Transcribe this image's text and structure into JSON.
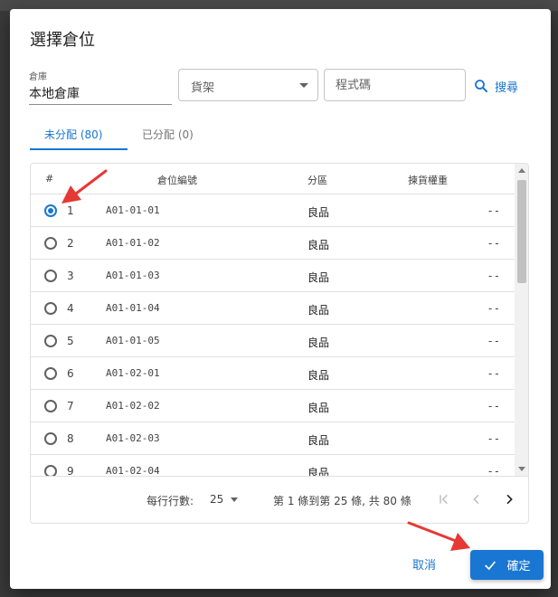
{
  "dialog": {
    "title": "選擇倉位",
    "warehouse": {
      "label": "倉庫",
      "value": "本地倉庫"
    },
    "shelf": {
      "placeholder": "貨架"
    },
    "code": {
      "placeholder": "程式碼"
    },
    "search_label": "搜尋",
    "tabs": [
      {
        "label": "未分配 (80)",
        "active": true
      },
      {
        "label": "已分配 (0)",
        "active": false
      }
    ],
    "table": {
      "headers": {
        "index": "#",
        "code": "倉位編號",
        "zone": "分區",
        "weight": "揀貨權重"
      },
      "rows": [
        {
          "num": "1",
          "code": "A01-01-01",
          "zone": "良品",
          "weight": "--",
          "selected": true
        },
        {
          "num": "2",
          "code": "A01-01-02",
          "zone": "良品",
          "weight": "--",
          "selected": false
        },
        {
          "num": "3",
          "code": "A01-01-03",
          "zone": "良品",
          "weight": "--",
          "selected": false
        },
        {
          "num": "4",
          "code": "A01-01-04",
          "zone": "良品",
          "weight": "--",
          "selected": false
        },
        {
          "num": "5",
          "code": "A01-01-05",
          "zone": "良品",
          "weight": "--",
          "selected": false
        },
        {
          "num": "6",
          "code": "A01-02-01",
          "zone": "良品",
          "weight": "--",
          "selected": false
        },
        {
          "num": "7",
          "code": "A01-02-02",
          "zone": "良品",
          "weight": "--",
          "selected": false
        },
        {
          "num": "8",
          "code": "A01-02-03",
          "zone": "良品",
          "weight": "--",
          "selected": false
        },
        {
          "num": "9",
          "code": "A01-02-04",
          "zone": "良品",
          "weight": "--",
          "selected": false
        }
      ]
    },
    "pagination": {
      "rows_per_page_label": "每行行數:",
      "rows_per_page": "25",
      "range_text": "第 1 條到第 25 條, 共 80 條"
    },
    "actions": {
      "cancel": "取消",
      "confirm": "確定"
    }
  },
  "colors": {
    "primary": "#1976d2",
    "annotation": "#e53935"
  }
}
